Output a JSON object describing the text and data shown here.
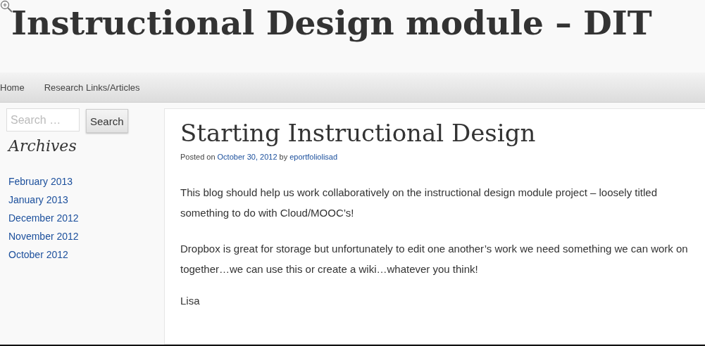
{
  "site_title": "Instructional Design module – DIT",
  "nav": [
    {
      "label": "Home"
    },
    {
      "label": "Research Links/Articles"
    }
  ],
  "search": {
    "placeholder": "Search …",
    "button": "Search"
  },
  "archives": {
    "title": "Archives",
    "items": [
      "February 2013",
      "January 2013",
      "December 2012",
      "November 2012",
      "October 2012"
    ]
  },
  "post": {
    "title": "Starting Instructional Design",
    "meta": {
      "prefix": "Posted on",
      "date": "October 30, 2012",
      "by": "by",
      "author": "eportfoliolisad"
    },
    "paragraphs": [
      "This blog should help us work collaboratively on the instructional design module project – loosely titled something to do with Cloud/MOOC’s!",
      "Dropbox is great for storage but unfortunately to edit one another’s work we need something we can work on together…we can use this or create a wiki…whatever you think!"
    ],
    "signature": "Lisa"
  }
}
